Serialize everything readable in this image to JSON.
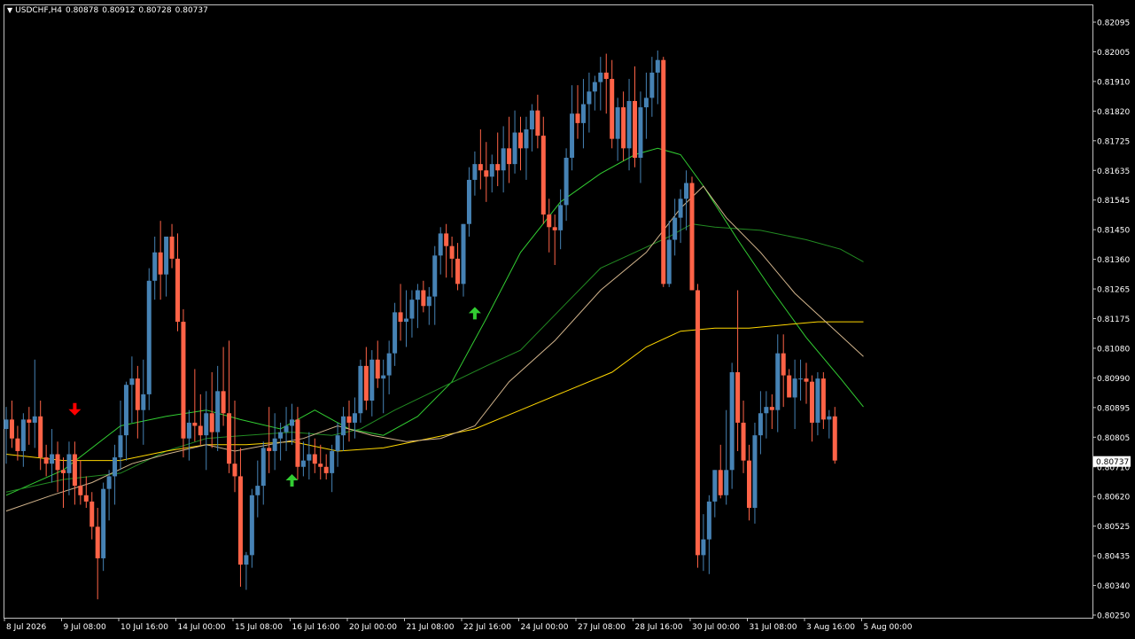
{
  "header": {
    "dropdown_icon": "triangle-down-icon",
    "symbol": "USDCHF,H4",
    "open": "0.80878",
    "high": "0.80912",
    "low": "0.80728",
    "close": "0.80737"
  },
  "colors": {
    "background": "#000000",
    "grid_frame": "#c0c0c0",
    "bull_candle": "#4682b4",
    "bear_candle": "#ff6347",
    "ma_fast": "#32cd32",
    "ma_medium": "#228b22",
    "ma_slow": "#ffd700",
    "ma_slowest": "#d2b48c",
    "sell_arrow": "#ff0000",
    "buy_arrow": "#32cd32",
    "price_label_bg": "#ffffff",
    "price_label_text": "#000000"
  },
  "chart_data": {
    "type": "candlestick",
    "symbol": "USDCHF",
    "timeframe": "H4",
    "current_price": "0.80737",
    "ylim": [
      0.8025,
      0.8213
    ],
    "y_ticks": [
      "0.82095",
      "0.82005",
      "0.81910",
      "0.81820",
      "0.81725",
      "0.81635",
      "0.81545",
      "0.81450",
      "0.81360",
      "0.81265",
      "0.81175",
      "0.81080",
      "0.80990",
      "0.80895",
      "0.80805",
      "0.80710",
      "0.80620",
      "0.80525",
      "0.80435",
      "0.80340",
      "0.80250"
    ],
    "x_ticks": [
      "8 Jul 2026",
      "9 Jul 08:00",
      "10 Jul 16:00",
      "14 Jul 00:00",
      "15 Jul 08:00",
      "16 Jul 16:00",
      "20 Jul 00:00",
      "21 Jul 08:00",
      "22 Jul 16:00",
      "24 Jul 00:00",
      "27 Jul 08:00",
      "28 Jul 16:00",
      "30 Jul 00:00",
      "31 Jul 08:00",
      "3 Aug 16:00",
      "5 Aug 00:00"
    ],
    "x_tick_index": [
      0,
      10,
      20,
      30,
      40,
      50,
      60,
      70,
      80,
      90,
      100,
      110,
      120,
      130,
      140,
      150
    ],
    "candles": [
      [
        0.8084,
        0.8091,
        0.8073,
        0.8087
      ],
      [
        0.8087,
        0.8093,
        0.8078,
        0.8081
      ],
      [
        0.8081,
        0.8085,
        0.8074,
        0.8077
      ],
      [
        0.8077,
        0.8089,
        0.8072,
        0.8087
      ],
      [
        0.8087,
        0.8091,
        0.8079,
        0.8086
      ],
      [
        0.8086,
        0.8106,
        0.8078,
        0.8088
      ],
      [
        0.8088,
        0.8093,
        0.8071,
        0.8075
      ],
      [
        0.8075,
        0.8079,
        0.8069,
        0.8073
      ],
      [
        0.8073,
        0.8084,
        0.8067,
        0.8076
      ],
      [
        0.8076,
        0.808,
        0.8064,
        0.8071
      ],
      [
        0.8071,
        0.8075,
        0.8059,
        0.807
      ],
      [
        0.807,
        0.808,
        0.8063,
        0.8076
      ],
      [
        0.8076,
        0.808,
        0.806,
        0.8066
      ],
      [
        0.8066,
        0.8074,
        0.806,
        0.8063
      ],
      [
        0.8063,
        0.8069,
        0.8059,
        0.8061
      ],
      [
        0.8061,
        0.8064,
        0.8049,
        0.8053
      ],
      [
        0.8053,
        0.8059,
        0.803,
        0.8043
      ],
      [
        0.8043,
        0.8067,
        0.8039,
        0.8065
      ],
      [
        0.8065,
        0.8071,
        0.8055,
        0.8069
      ],
      [
        0.8069,
        0.8079,
        0.806,
        0.8075
      ],
      [
        0.8075,
        0.8093,
        0.8071,
        0.8082
      ],
      [
        0.8082,
        0.8099,
        0.8074,
        0.8098
      ],
      [
        0.8098,
        0.8107,
        0.8086,
        0.81
      ],
      [
        0.81,
        0.8104,
        0.8081,
        0.809
      ],
      [
        0.809,
        0.8106,
        0.8079,
        0.8095
      ],
      [
        0.8095,
        0.8135,
        0.809,
        0.8131
      ],
      [
        0.8131,
        0.8145,
        0.8125,
        0.814
      ],
      [
        0.814,
        0.815,
        0.8125,
        0.8133
      ],
      [
        0.8133,
        0.8143,
        0.8126,
        0.8145
      ],
      [
        0.8145,
        0.8149,
        0.8135,
        0.8138
      ],
      [
        0.8138,
        0.8146,
        0.8115,
        0.8118
      ],
      [
        0.8118,
        0.8122,
        0.8075,
        0.8081
      ],
      [
        0.8081,
        0.809,
        0.8074,
        0.8086
      ],
      [
        0.8086,
        0.8103,
        0.808,
        0.8085
      ],
      [
        0.8085,
        0.8095,
        0.8079,
        0.8082
      ],
      [
        0.8082,
        0.8096,
        0.8071,
        0.8089
      ],
      [
        0.8089,
        0.8102,
        0.8078,
        0.8083
      ],
      [
        0.8083,
        0.8104,
        0.8077,
        0.8096
      ],
      [
        0.8096,
        0.811,
        0.8085,
        0.8089
      ],
      [
        0.8089,
        0.8112,
        0.807,
        0.8073
      ],
      [
        0.8073,
        0.8093,
        0.8064,
        0.8069
      ],
      [
        0.8069,
        0.8078,
        0.8034,
        0.8041
      ],
      [
        0.8041,
        0.8045,
        0.8033,
        0.8044
      ],
      [
        0.8044,
        0.8065,
        0.804,
        0.8063
      ],
      [
        0.8063,
        0.8074,
        0.8056,
        0.8066
      ],
      [
        0.8066,
        0.808,
        0.806,
        0.8078
      ],
      [
        0.8078,
        0.8091,
        0.807,
        0.8077
      ],
      [
        0.8077,
        0.8089,
        0.8071,
        0.8081
      ],
      [
        0.8081,
        0.8086,
        0.8074,
        0.8083
      ],
      [
        0.8083,
        0.8091,
        0.8077,
        0.8085
      ],
      [
        0.8085,
        0.8092,
        0.8079,
        0.8087
      ],
      [
        0.8087,
        0.8091,
        0.8068,
        0.8072
      ],
      [
        0.8072,
        0.808,
        0.8069,
        0.8074
      ],
      [
        0.8074,
        0.8083,
        0.8068,
        0.8076
      ],
      [
        0.8076,
        0.8081,
        0.807,
        0.8073
      ],
      [
        0.8073,
        0.8079,
        0.8068,
        0.8072
      ],
      [
        0.8072,
        0.8076,
        0.8068,
        0.807
      ],
      [
        0.807,
        0.8079,
        0.8064,
        0.8077
      ],
      [
        0.8077,
        0.8086,
        0.8072,
        0.8082
      ],
      [
        0.8082,
        0.8091,
        0.8077,
        0.8088
      ],
      [
        0.8088,
        0.8093,
        0.808,
        0.8086
      ],
      [
        0.8086,
        0.8094,
        0.8081,
        0.8089
      ],
      [
        0.8089,
        0.8106,
        0.8086,
        0.8104
      ],
      [
        0.8104,
        0.811,
        0.809,
        0.8093
      ],
      [
        0.8093,
        0.8109,
        0.8088,
        0.8106
      ],
      [
        0.8106,
        0.8112,
        0.8097,
        0.81
      ],
      [
        0.81,
        0.8106,
        0.8089,
        0.8101
      ],
      [
        0.8101,
        0.8112,
        0.8095,
        0.8108
      ],
      [
        0.8108,
        0.8124,
        0.8104,
        0.8121
      ],
      [
        0.8121,
        0.813,
        0.8112,
        0.8118
      ],
      [
        0.8118,
        0.8128,
        0.811,
        0.8119
      ],
      [
        0.8119,
        0.8128,
        0.8113,
        0.8125
      ],
      [
        0.8125,
        0.813,
        0.8116,
        0.8128
      ],
      [
        0.8128,
        0.8131,
        0.8121,
        0.8123
      ],
      [
        0.8123,
        0.8129,
        0.8117,
        0.8126
      ],
      [
        0.8126,
        0.8142,
        0.8117,
        0.8139
      ],
      [
        0.8139,
        0.8148,
        0.8133,
        0.8146
      ],
      [
        0.8146,
        0.8149,
        0.8132,
        0.8142
      ],
      [
        0.8142,
        0.8145,
        0.8132,
        0.8138
      ],
      [
        0.8138,
        0.8143,
        0.8128,
        0.813
      ],
      [
        0.813,
        0.8149,
        0.8126,
        0.8149
      ],
      [
        0.8149,
        0.8167,
        0.8145,
        0.8163
      ],
      [
        0.8163,
        0.8172,
        0.8158,
        0.8168
      ],
      [
        0.8168,
        0.8179,
        0.816,
        0.8166
      ],
      [
        0.8166,
        0.8175,
        0.8156,
        0.8164
      ],
      [
        0.8164,
        0.8171,
        0.8159,
        0.8168
      ],
      [
        0.8168,
        0.8178,
        0.8161,
        0.8166
      ],
      [
        0.8166,
        0.818,
        0.8159,
        0.8173
      ],
      [
        0.8173,
        0.8183,
        0.8162,
        0.8168
      ],
      [
        0.8168,
        0.8185,
        0.8165,
        0.8178
      ],
      [
        0.8178,
        0.8183,
        0.8166,
        0.8173
      ],
      [
        0.8173,
        0.8183,
        0.8163,
        0.8179
      ],
      [
        0.8179,
        0.8187,
        0.8172,
        0.8185
      ],
      [
        0.8185,
        0.819,
        0.8173,
        0.8177
      ],
      [
        0.8177,
        0.8183,
        0.8149,
        0.8152
      ],
      [
        0.8152,
        0.8157,
        0.814,
        0.8148
      ],
      [
        0.8148,
        0.8152,
        0.8136,
        0.8147
      ],
      [
        0.8147,
        0.816,
        0.8141,
        0.8155
      ],
      [
        0.8155,
        0.8173,
        0.815,
        0.817
      ],
      [
        0.817,
        0.8193,
        0.8166,
        0.8184
      ],
      [
        0.8184,
        0.8193,
        0.8176,
        0.8181
      ],
      [
        0.8181,
        0.8195,
        0.8173,
        0.8187
      ],
      [
        0.8187,
        0.8197,
        0.8178,
        0.8191
      ],
      [
        0.8191,
        0.8196,
        0.8185,
        0.8194
      ],
      [
        0.8194,
        0.8202,
        0.8185,
        0.8197
      ],
      [
        0.8197,
        0.8203,
        0.8184,
        0.8195
      ],
      [
        0.8195,
        0.8201,
        0.8173,
        0.8176
      ],
      [
        0.8176,
        0.8189,
        0.8169,
        0.8186
      ],
      [
        0.8186,
        0.8191,
        0.8169,
        0.8173
      ],
      [
        0.8173,
        0.8195,
        0.8166,
        0.8188
      ],
      [
        0.8188,
        0.8199,
        0.8167,
        0.817
      ],
      [
        0.817,
        0.8191,
        0.8162,
        0.8186
      ],
      [
        0.8186,
        0.8197,
        0.8176,
        0.8189
      ],
      [
        0.8189,
        0.8202,
        0.8183,
        0.8197
      ],
      [
        0.8197,
        0.8204,
        0.8187,
        0.8201
      ],
      [
        0.8201,
        0.8202,
        0.8129,
        0.813
      ],
      [
        0.813,
        0.815,
        0.8129,
        0.8144
      ],
      [
        0.8144,
        0.8157,
        0.8139,
        0.8151
      ],
      [
        0.8151,
        0.816,
        0.8143,
        0.8157
      ],
      [
        0.8157,
        0.8166,
        0.8147,
        0.8162
      ],
      [
        0.8162,
        0.8164,
        0.8128,
        0.8128
      ],
      [
        0.8128,
        0.813,
        0.804,
        0.8044
      ],
      [
        0.8044,
        0.8057,
        0.8039,
        0.8049
      ],
      [
        0.8049,
        0.8063,
        0.8038,
        0.8061
      ],
      [
        0.8061,
        0.8071,
        0.8056,
        0.8071
      ],
      [
        0.8071,
        0.8079,
        0.8062,
        0.8063
      ],
      [
        0.8063,
        0.809,
        0.806,
        0.8071
      ],
      [
        0.8071,
        0.8105,
        0.8065,
        0.8102
      ],
      [
        0.8102,
        0.8128,
        0.8077,
        0.8086
      ],
      [
        0.8086,
        0.8093,
        0.807,
        0.8074
      ],
      [
        0.8074,
        0.8079,
        0.8055,
        0.8059
      ],
      [
        0.8059,
        0.8086,
        0.8054,
        0.8082
      ],
      [
        0.8082,
        0.8096,
        0.8076,
        0.8089
      ],
      [
        0.8089,
        0.8096,
        0.8081,
        0.8091
      ],
      [
        0.8091,
        0.8095,
        0.8084,
        0.809
      ],
      [
        0.809,
        0.8114,
        0.8083,
        0.8108
      ],
      [
        0.8108,
        0.8114,
        0.8091,
        0.8101
      ],
      [
        0.8101,
        0.8103,
        0.8094,
        0.8094
      ],
      [
        0.8094,
        0.8106,
        0.8084,
        0.81
      ],
      [
        0.81,
        0.8106,
        0.8093,
        0.81
      ],
      [
        0.81,
        0.8105,
        0.8092,
        0.8099
      ],
      [
        0.8099,
        0.8101,
        0.808,
        0.8086
      ],
      [
        0.8086,
        0.8102,
        0.8082,
        0.81
      ],
      [
        0.81,
        0.8102,
        0.8084,
        0.8087
      ],
      [
        0.8087,
        0.809,
        0.8081,
        0.8088
      ],
      [
        0.8088,
        0.8091,
        0.8073,
        0.8074
      ]
    ],
    "moving_averages": [
      {
        "points": [
          [
            0,
            0.8063
          ],
          [
            10,
            0.8071
          ],
          [
            20,
            0.8085
          ],
          [
            28,
            0.8088
          ],
          [
            35,
            0.809
          ],
          [
            41,
            0.8087
          ],
          [
            48,
            0.8084
          ],
          [
            54,
            0.809
          ],
          [
            60,
            0.8084
          ],
          [
            66,
            0.8082
          ],
          [
            72,
            0.8088
          ],
          [
            78,
            0.8099
          ],
          [
            84,
            0.8119
          ],
          [
            90,
            0.814
          ],
          [
            97,
            0.8156
          ],
          [
            104,
            0.8165
          ],
          [
            110,
            0.8171
          ],
          [
            114,
            0.8173
          ],
          [
            118,
            0.8171
          ],
          [
            122,
            0.8161
          ],
          [
            128,
            0.8144
          ],
          [
            134,
            0.8128
          ],
          [
            140,
            0.8113
          ],
          [
            146,
            0.81
          ],
          [
            150,
            0.8091
          ]
        ]
      },
      {
        "points": [
          [
            0,
            0.8064
          ],
          [
            10,
            0.8068
          ],
          [
            20,
            0.807
          ],
          [
            28,
            0.8077
          ],
          [
            35,
            0.8081
          ],
          [
            42,
            0.8082
          ],
          [
            50,
            0.8083
          ],
          [
            57,
            0.8082
          ],
          [
            62,
            0.8084
          ],
          [
            68,
            0.809
          ],
          [
            76,
            0.8097
          ],
          [
            84,
            0.8104
          ],
          [
            90,
            0.8109
          ],
          [
            97,
            0.8122
          ],
          [
            104,
            0.8135
          ],
          [
            110,
            0.814
          ],
          [
            116,
            0.8145
          ],
          [
            120,
            0.8149
          ],
          [
            124,
            0.8148
          ],
          [
            132,
            0.8147
          ],
          [
            140,
            0.8144
          ],
          [
            146,
            0.8141
          ],
          [
            150,
            0.8137
          ]
        ]
      },
      {
        "points": [
          [
            0,
            0.8076
          ],
          [
            10,
            0.8074
          ],
          [
            20,
            0.8074
          ],
          [
            28,
            0.8077
          ],
          [
            35,
            0.8079
          ],
          [
            42,
            0.8079
          ],
          [
            50,
            0.808
          ],
          [
            58,
            0.8077
          ],
          [
            66,
            0.8078
          ],
          [
            74,
            0.8081
          ],
          [
            82,
            0.8084
          ],
          [
            90,
            0.809
          ],
          [
            98,
            0.8096
          ],
          [
            106,
            0.8102
          ],
          [
            112,
            0.811
          ],
          [
            118,
            0.8115
          ],
          [
            124,
            0.8116
          ],
          [
            130,
            0.8116
          ],
          [
            136,
            0.8117
          ],
          [
            142,
            0.8118
          ],
          [
            150,
            0.8118
          ]
        ]
      },
      {
        "points": [
          [
            0,
            0.8058
          ],
          [
            8,
            0.8063
          ],
          [
            15,
            0.8067
          ],
          [
            22,
            0.8073
          ],
          [
            28,
            0.8076
          ],
          [
            35,
            0.8079
          ],
          [
            40,
            0.8077
          ],
          [
            46,
            0.8079
          ],
          [
            52,
            0.8081
          ],
          [
            58,
            0.8085
          ],
          [
            64,
            0.8082
          ],
          [
            70,
            0.808
          ],
          [
            76,
            0.8081
          ],
          [
            82,
            0.8085
          ],
          [
            88,
            0.8099
          ],
          [
            96,
            0.8112
          ],
          [
            104,
            0.8128
          ],
          [
            112,
            0.814
          ],
          [
            118,
            0.8154
          ],
          [
            122,
            0.8161
          ],
          [
            126,
            0.8151
          ],
          [
            132,
            0.814
          ],
          [
            138,
            0.8127
          ],
          [
            144,
            0.8117
          ],
          [
            150,
            0.8107
          ]
        ]
      }
    ],
    "arrows": [
      {
        "type": "sell",
        "index": 12,
        "price": 0.809
      },
      {
        "type": "buy",
        "index": 50,
        "price": 0.8068
      },
      {
        "type": "buy",
        "index": 82,
        "price": 0.8121
      }
    ]
  }
}
